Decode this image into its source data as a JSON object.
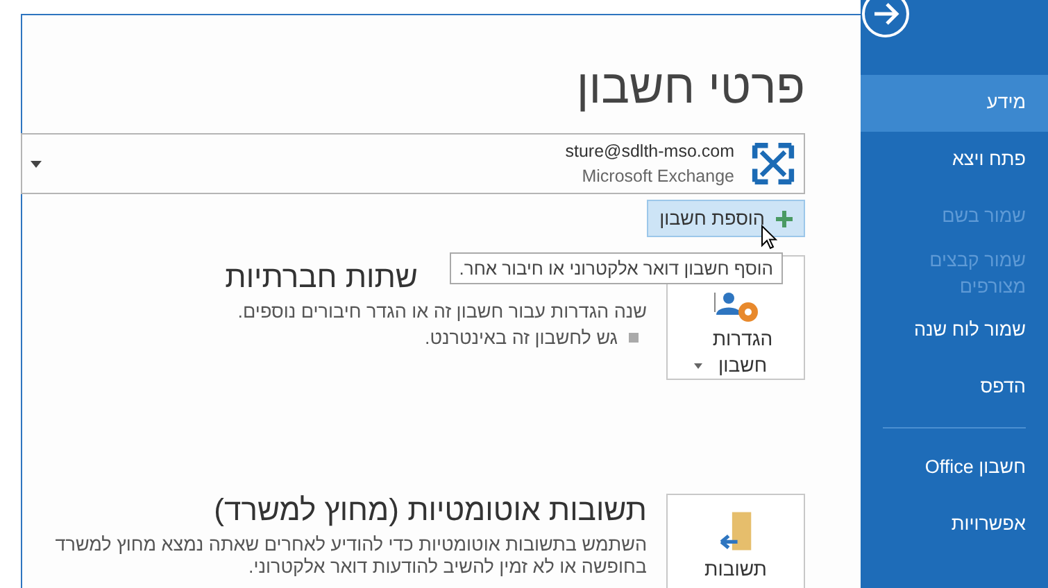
{
  "main": {
    "title": "פרטי חשבון",
    "account": {
      "email": "sture@sdlth-mso.com",
      "type": "Microsoft Exchange"
    },
    "add_account_button": "הוספת חשבון",
    "tooltip": "הוסף חשבון דואר אלקטרוני או חיבור אחר.",
    "sections": [
      {
        "kind": "settings",
        "card_label": "הגדרות חשבון",
        "card_dropdown": true,
        "heading": "שתות חברתיות",
        "description": "שנה הגדרות עבור חשבון זה או הגדר חיבורים נוספים.",
        "bullets": [
          "גש לחשבון זה באינטרנט."
        ]
      },
      {
        "kind": "auto-reply",
        "card_label": "תשובות",
        "heading": "תשובות אוטומטיות (מחוץ למשרד)",
        "description": "השתמש בתשובות אוטומטיות כדי להודיע לאחרים שאתה נמצא מחוץ למשרד בחופשה או לא זמין להשיב להודעות דואר אלקטרוני."
      }
    ]
  },
  "sidebar": {
    "items": [
      {
        "label": "מידע",
        "selected": true,
        "disabled": false
      },
      {
        "label": "פתח ויצא",
        "selected": false,
        "disabled": false
      },
      {
        "label": "שמור בשם",
        "selected": false,
        "disabled": true
      },
      {
        "label": "שמור קבצים מצורפים",
        "selected": false,
        "disabled": true
      },
      {
        "label": "שמור לוח שנה",
        "selected": false,
        "disabled": false
      },
      {
        "label": "הדפס",
        "selected": false,
        "disabled": false
      }
    ],
    "footer_items": [
      {
        "label": "חשבון Office",
        "selected": false,
        "disabled": false
      },
      {
        "label": "אפשרויות",
        "selected": false,
        "disabled": false
      }
    ]
  }
}
